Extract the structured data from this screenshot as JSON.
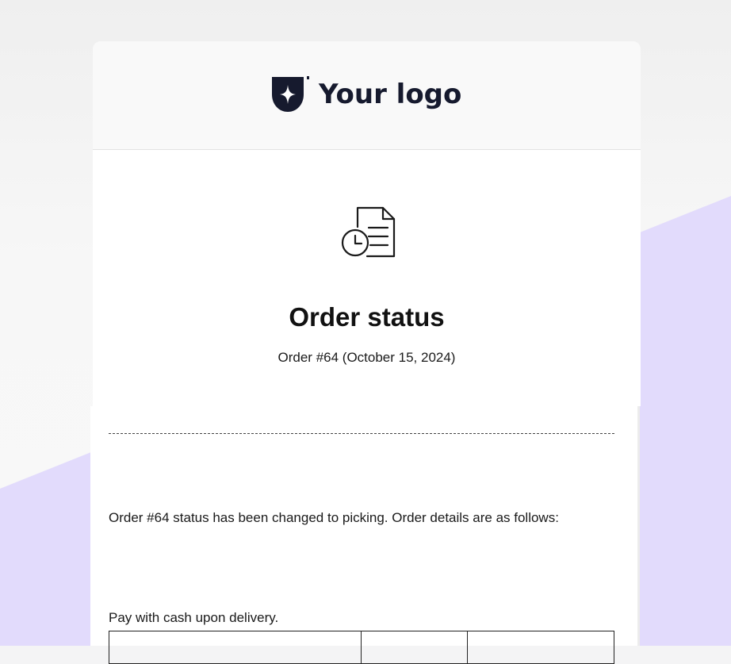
{
  "brand": {
    "logo_text": "Your logo",
    "logo_icon": "shield-sparkle-icon"
  },
  "header": {
    "icon": "document-clock-icon",
    "title": "Order status",
    "subtitle": "Order #64 (October 15, 2024)"
  },
  "content": {
    "status_message": "Order #64 status has been changed to picking. Order details are as follows:",
    "payment_note": "Pay with cash upon delivery."
  },
  "colors": {
    "background": "#f4f4f5",
    "band": "#e2dbfc",
    "logo": "#161a2e",
    "text": "#111111"
  }
}
